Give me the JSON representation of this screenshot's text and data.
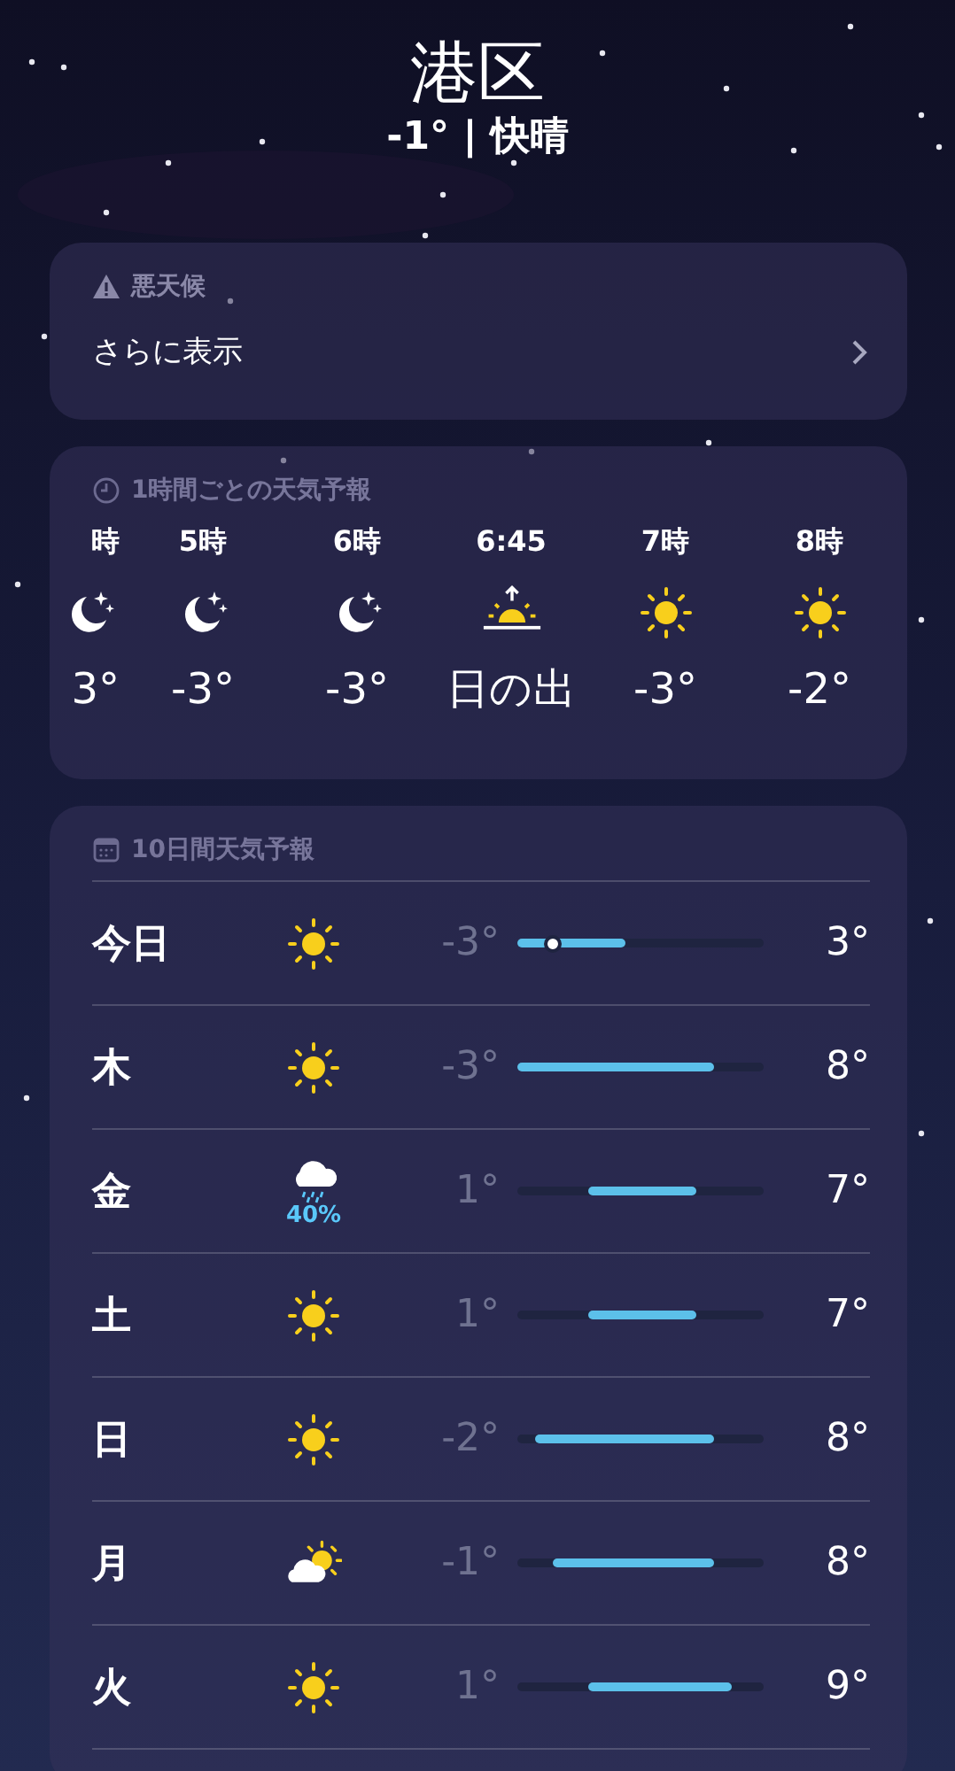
{
  "location": {
    "name": "港区",
    "summary": "-1° | 快晴"
  },
  "alert": {
    "title": "悪天候",
    "link": "さらに表示"
  },
  "hourly": {
    "title": "1時間ごとの天気予報",
    "hours": [
      {
        "time": "時",
        "kind": "moon",
        "temp": "3°"
      },
      {
        "time": "5時",
        "kind": "moon",
        "temp": "-3°"
      },
      {
        "time": "6時",
        "kind": "moon",
        "temp": "-3°"
      },
      {
        "time": "6:45",
        "kind": "sunrise",
        "temp": "日の出"
      },
      {
        "time": "7時",
        "kind": "sun",
        "temp": "-3°"
      },
      {
        "time": "8時",
        "kind": "sun",
        "temp": "-2°"
      }
    ]
  },
  "daily": {
    "title": "10日間天気予報",
    "days": [
      {
        "day": "今日",
        "kind": "sun",
        "low": "-3°",
        "high": "3°",
        "current": true
      },
      {
        "day": "木",
        "kind": "sun",
        "low": "-3°",
        "high": "8°",
        "current": false
      },
      {
        "day": "金",
        "kind": "rain",
        "chance": "40%",
        "low": "1°",
        "high": "7°",
        "current": false
      },
      {
        "day": "土",
        "kind": "sun",
        "low": "1°",
        "high": "7°",
        "current": false
      },
      {
        "day": "日",
        "kind": "sun",
        "low": "-2°",
        "high": "8°",
        "current": false
      },
      {
        "day": "月",
        "kind": "partly",
        "low": "-1°",
        "high": "8°",
        "current": false
      },
      {
        "day": "火",
        "kind": "sun",
        "low": "1°",
        "high": "9°",
        "current": false
      }
    ]
  }
}
